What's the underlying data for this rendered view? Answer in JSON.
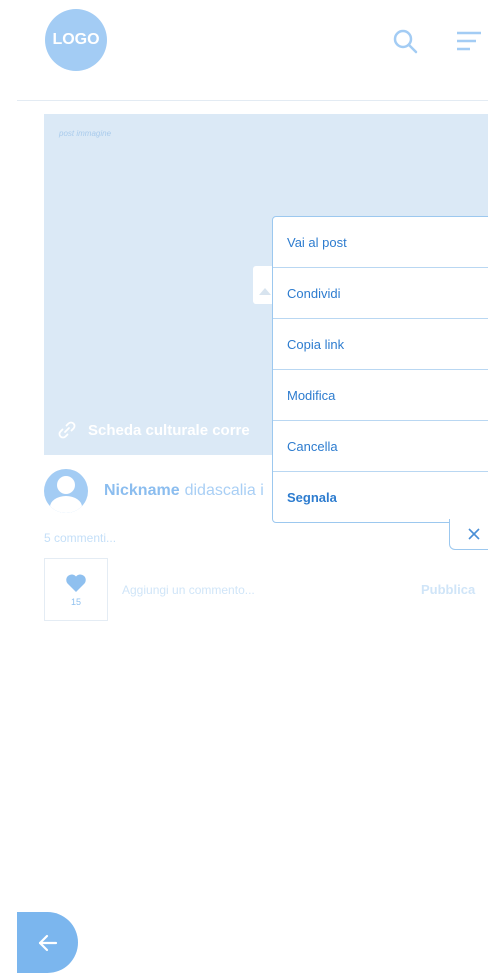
{
  "header": {
    "logo_text": "LOGO",
    "search_icon": "search-icon",
    "menu_icon": "hamburger-menu-icon"
  },
  "post": {
    "image_label": "post immagine",
    "card_link": "Scheda culturale corre",
    "author": "Nickname",
    "caption": "didascalia i",
    "comments_count": "5 commenti...",
    "likes": "15",
    "comment_placeholder": "Aggiungi un commento...",
    "publish_label": "Pubblica"
  },
  "context_menu": {
    "items": [
      {
        "label": "Vai al post"
      },
      {
        "label": "Condividi"
      },
      {
        "label": "Copia link"
      },
      {
        "label": "Modifica"
      },
      {
        "label": "Cancella"
      },
      {
        "label": "Segnala"
      }
    ],
    "close_icon": "close-icon"
  },
  "nav": {
    "back_icon": "arrow-left-icon"
  },
  "colors": {
    "accent": "#a3ccf4",
    "menu_text": "#2d7ccf",
    "menu_border": "#9cc8ef",
    "image_bg": "#dbe9f6"
  }
}
